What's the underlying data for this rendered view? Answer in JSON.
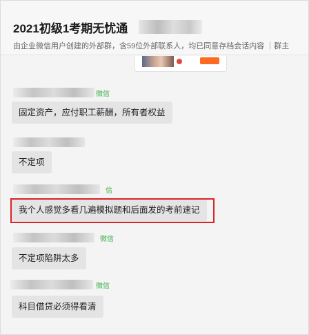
{
  "header": {
    "title": "2021初级1考期无忧通",
    "subtitle": "由企业微信用户创建的外部群，含59位外部联系人，均已同意存档会话内容  ｜群主"
  },
  "messages": [
    {
      "sender_tag": "微信",
      "text": "固定资产，应付职工薪酬，所有者权益"
    },
    {
      "sender_tag": "",
      "text": "不定项"
    },
    {
      "sender_tag": "信",
      "text": "我个人感觉多看几遍模拟题和后面发的考前速记"
    },
    {
      "sender_tag": "微信",
      "text": "不定项陷阱太多"
    },
    {
      "sender_tag": "微信",
      "text": "科目借贷必须得看清"
    }
  ],
  "colors": {
    "highlight": "#d8232a",
    "wechat_tag": "#3fae49",
    "bubble": "#e4e4e4"
  }
}
